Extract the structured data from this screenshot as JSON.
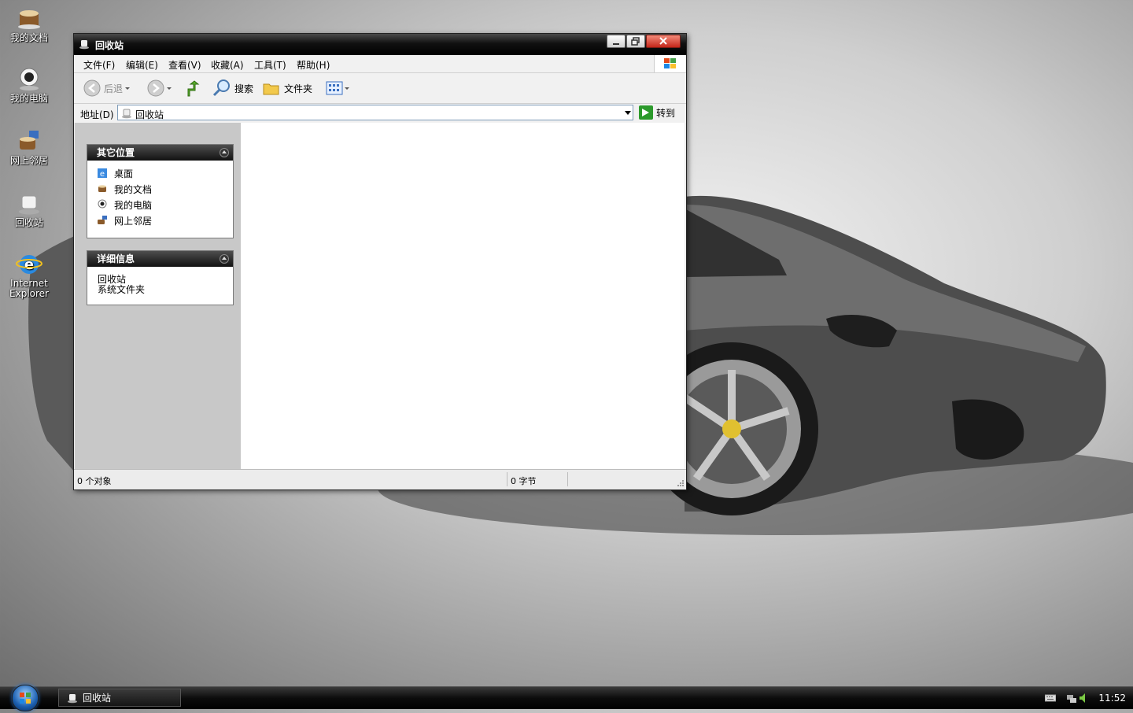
{
  "desktop": {
    "icons": [
      {
        "label": "我的文档",
        "icon": "my-documents-icon"
      },
      {
        "label": "我的电脑",
        "icon": "my-computer-icon"
      },
      {
        "label": "网上邻居",
        "icon": "network-places-icon"
      },
      {
        "label": "回收站",
        "icon": "recycle-bin-icon"
      },
      {
        "label1": "Internet",
        "label2": "Explorer",
        "icon": "internet-explorer-icon"
      }
    ]
  },
  "window": {
    "title": "回收站",
    "menu": [
      "文件(F)",
      "编辑(E)",
      "查看(V)",
      "收藏(A)",
      "工具(T)",
      "帮助(H)"
    ],
    "toolbar": {
      "back_label": "后退",
      "search_label": "搜索",
      "folders_label": "文件夹"
    },
    "address": {
      "label": "地址(D)",
      "value": "回收站",
      "go_label": "转到"
    },
    "other_places": {
      "title": "其它位置",
      "links": [
        "桌面",
        "我的文档",
        "我的电脑",
        "网上邻居"
      ]
    },
    "details": {
      "title": "详细信息",
      "name": "回收站",
      "type": "系统文件夹"
    },
    "status": {
      "objects": "0 个对象",
      "size": "0 字节"
    }
  },
  "taskbar": {
    "task_button_label": "回收站",
    "clock": "11:52"
  },
  "colors": {
    "window_title_bg": "#111111",
    "close_button": "#c4261a",
    "taskbar_bg": "#0c0c0c",
    "start_orb": "#1b5fb0"
  }
}
